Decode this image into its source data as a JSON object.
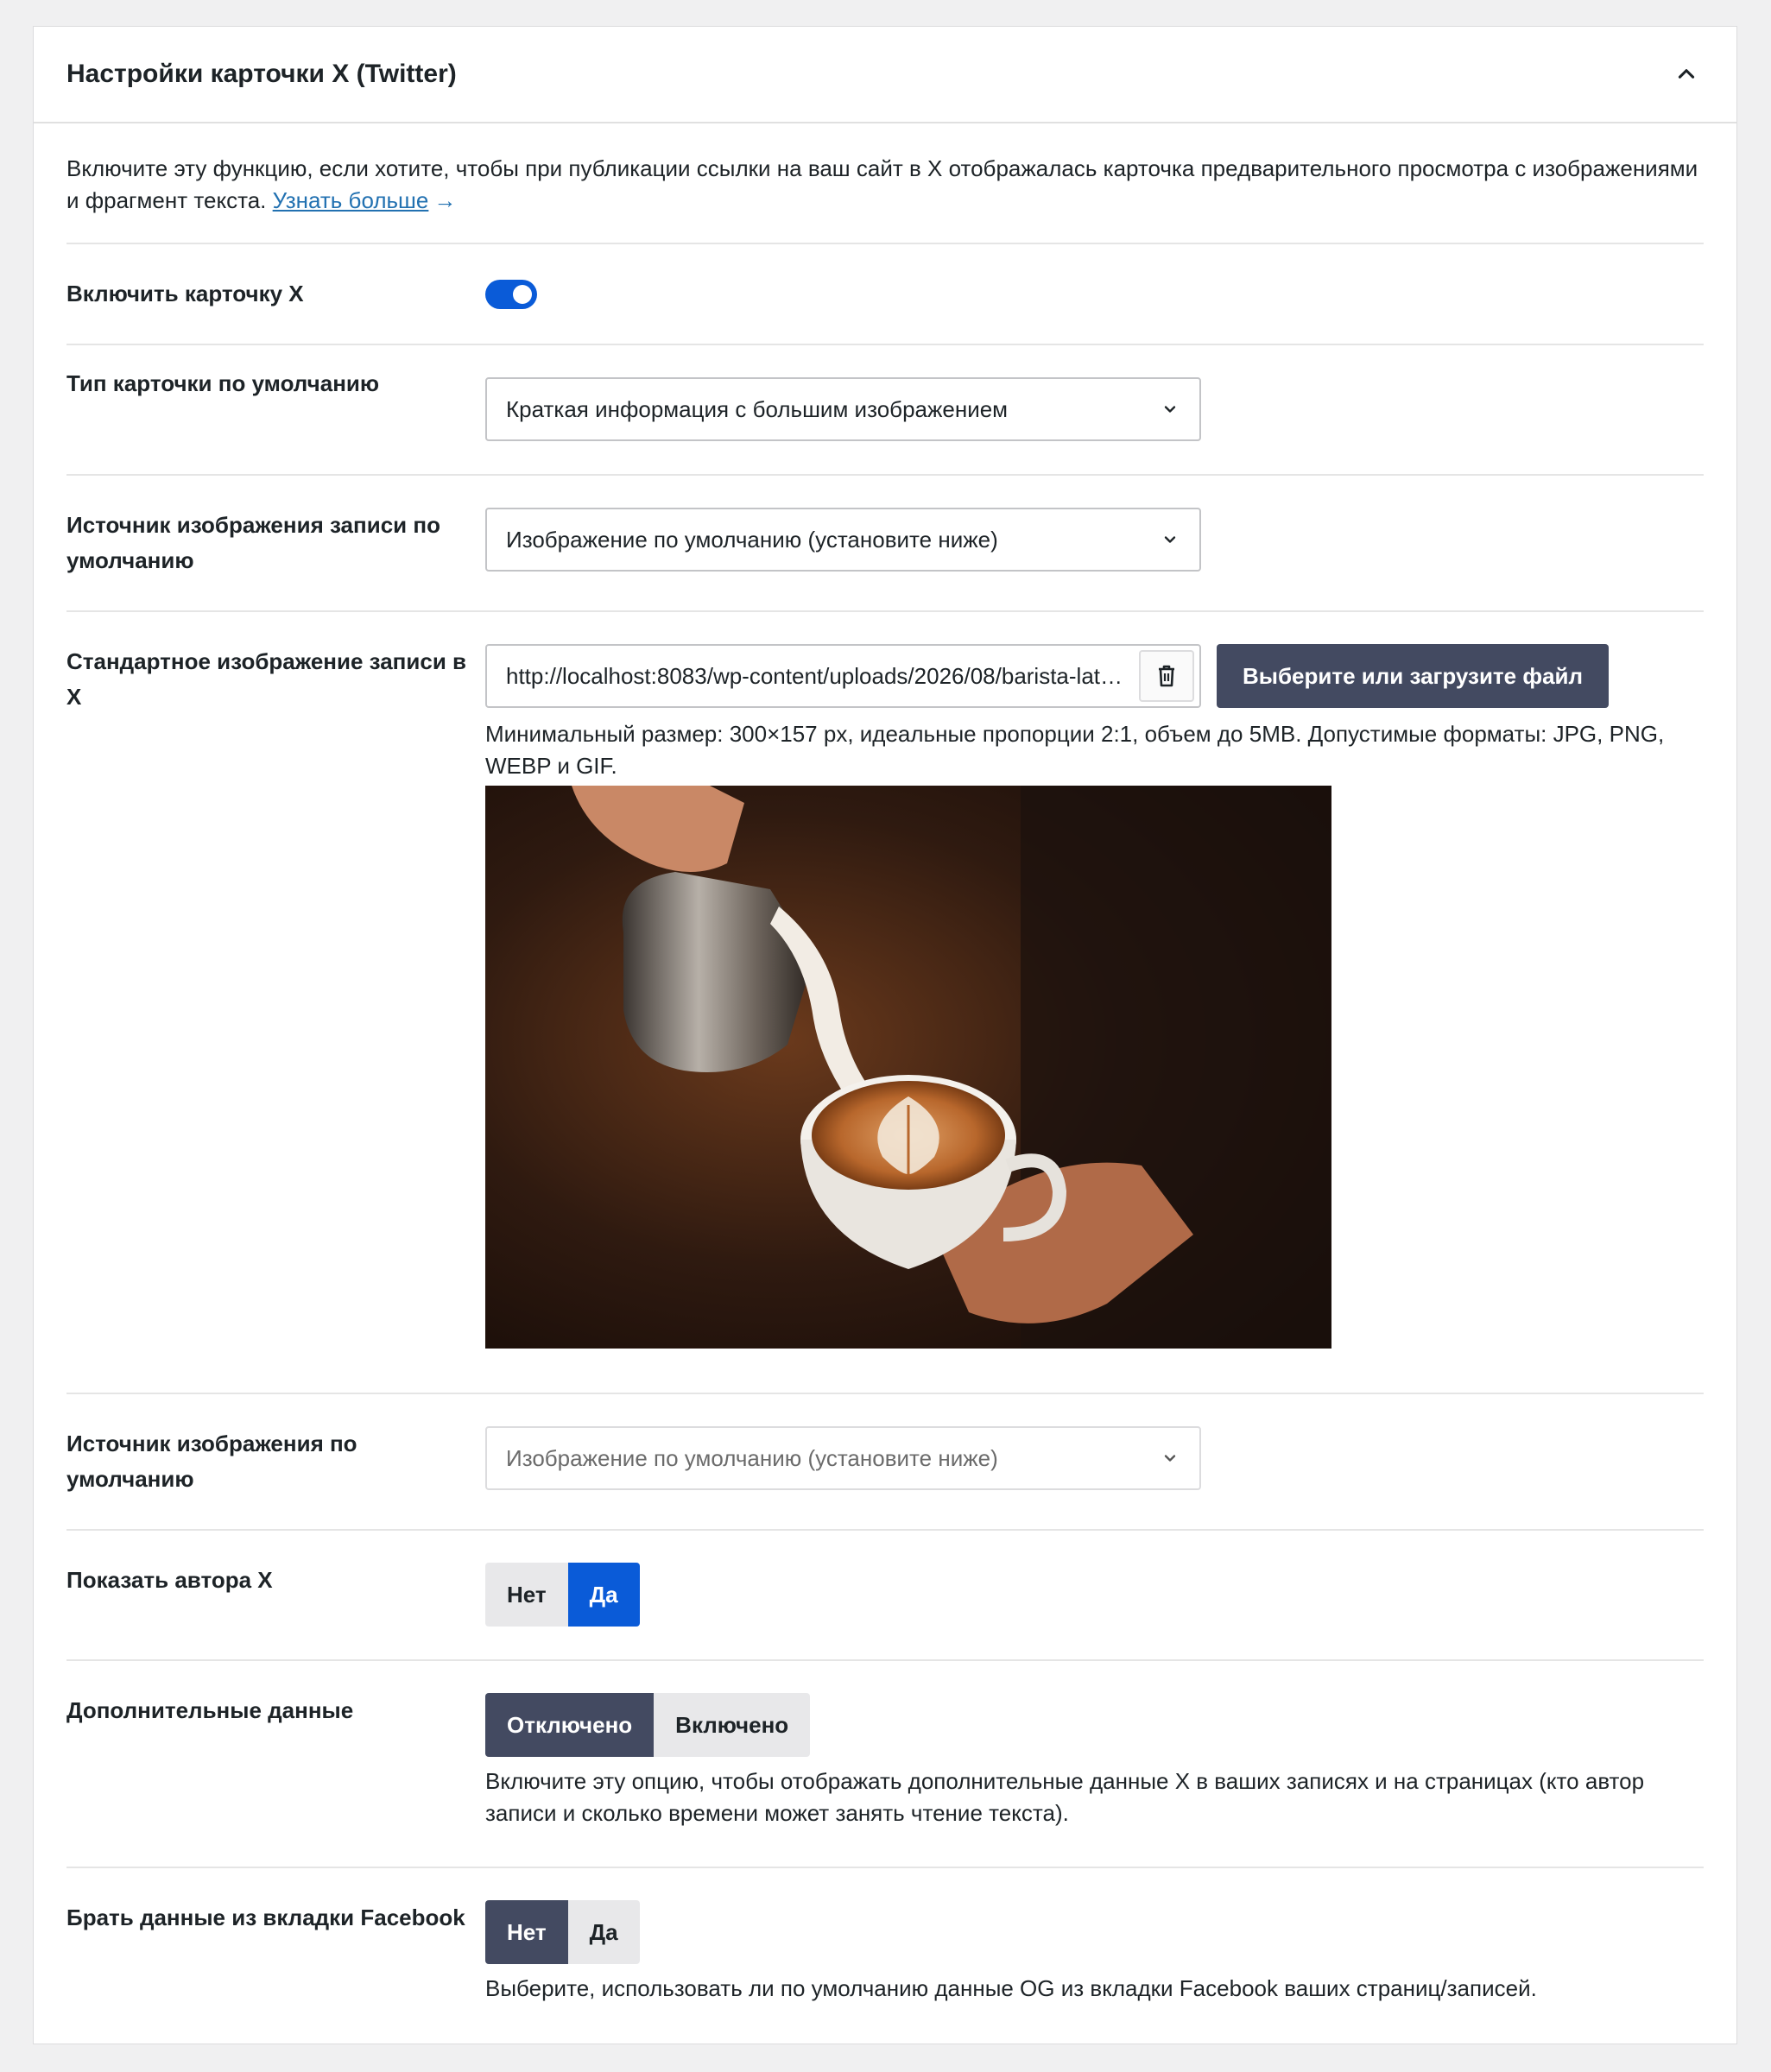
{
  "panel": {
    "title": "Настройки карточки X (Twitter)"
  },
  "intro": {
    "text": "Включите эту функцию, если хотите, чтобы при публикации ссылки на ваш сайт в X отображалась карточка предварительного просмотра с изображениями и фрагмент текста.",
    "link_label": "Узнать больше",
    "link_arrow": "→"
  },
  "fields": {
    "enable": {
      "label": "Включить карточку X",
      "on": true
    },
    "card_type": {
      "label": "Тип карточки по умолчанию",
      "value": "Краткая информация с большим изображением"
    },
    "post_image_source": {
      "label": "Источник изображения записи по умолчанию",
      "value": "Изображение по умолчанию (установите ниже)"
    },
    "default_image": {
      "label": "Стандартное изображение записи в X",
      "url": "http://localhost:8083/wp-content/uploads/2026/08/barista-latte-art.jpg",
      "upload_label": "Выберите или загрузите файл",
      "help": "Минимальный размер: 300×157 px, идеальные пропорции 2:1, объем до 5MB. Допустимые форматы: JPG, PNG, WEBP и GIF."
    },
    "image_source": {
      "label": "Источник изображения по умолчанию",
      "value": "Изображение по умолчанию (установите ниже)"
    },
    "show_author": {
      "label": "Показать автора X",
      "options": [
        "Нет",
        "Да"
      ],
      "selected": "Да"
    },
    "additional_data": {
      "label": "Дополнительные данные",
      "options": [
        "Отключено",
        "Включено"
      ],
      "selected": "Отключено",
      "help": "Включите эту опцию, чтобы отображать дополнительные данные X в ваших записях и на страницах (кто автор записи и сколько времени может занять чтение текста)."
    },
    "use_facebook": {
      "label": "Брать данные из вкладки Facebook",
      "options": [
        "Нет",
        "Да"
      ],
      "selected": "Нет",
      "help": "Выберите, использовать ли по умолчанию данные OG из вкладки Facebook ваших страниц/записей."
    }
  },
  "colors": {
    "accent_blue": "#0a5bd8",
    "dark_button": "#434a61",
    "link": "#2271b1"
  },
  "icons": {
    "collapse": "chevron-up-icon",
    "select": "chevron-down-icon",
    "delete": "trash-icon"
  }
}
